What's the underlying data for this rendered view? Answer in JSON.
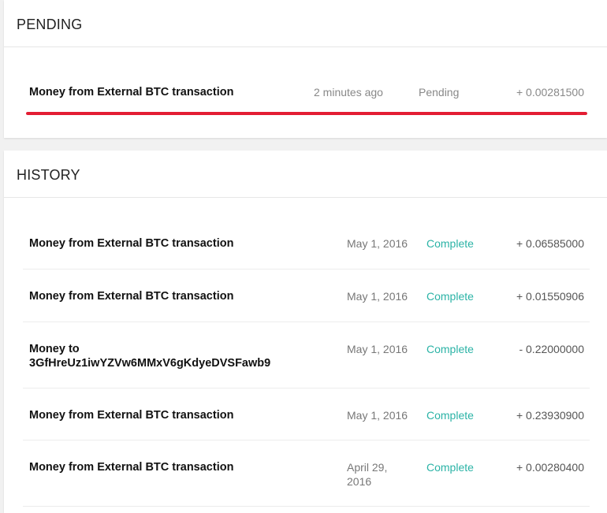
{
  "pending": {
    "title": "PENDING",
    "item": {
      "description": "Money from External BTC transaction",
      "time": "2 minutes ago",
      "status": "Pending",
      "amount": "+ 0.00281500",
      "progress": 1.0,
      "progress_color": "#e31d33"
    }
  },
  "history": {
    "title": "HISTORY",
    "status_color": "#2bb3a6",
    "items": [
      {
        "description": "Money from External BTC transaction",
        "date": "May 1, 2016",
        "status": "Complete",
        "amount": "+ 0.06585000"
      },
      {
        "description": "Money from External BTC transaction",
        "date": "May 1, 2016",
        "status": "Complete",
        "amount": "+ 0.01550906"
      },
      {
        "description": "Money to 3GfHreUz1iwYZVw6MMxV6gKdyeDVSFawb9",
        "date": "May 1, 2016",
        "status": "Complete",
        "amount": "- 0.22000000"
      },
      {
        "description": "Money from External BTC transaction",
        "date": "May 1, 2016",
        "status": "Complete",
        "amount": "+ 0.23930900"
      },
      {
        "description": "Money from External BTC transaction",
        "date": "April 29, 2016",
        "status": "Complete",
        "amount": "+ 0.00280400"
      }
    ]
  }
}
